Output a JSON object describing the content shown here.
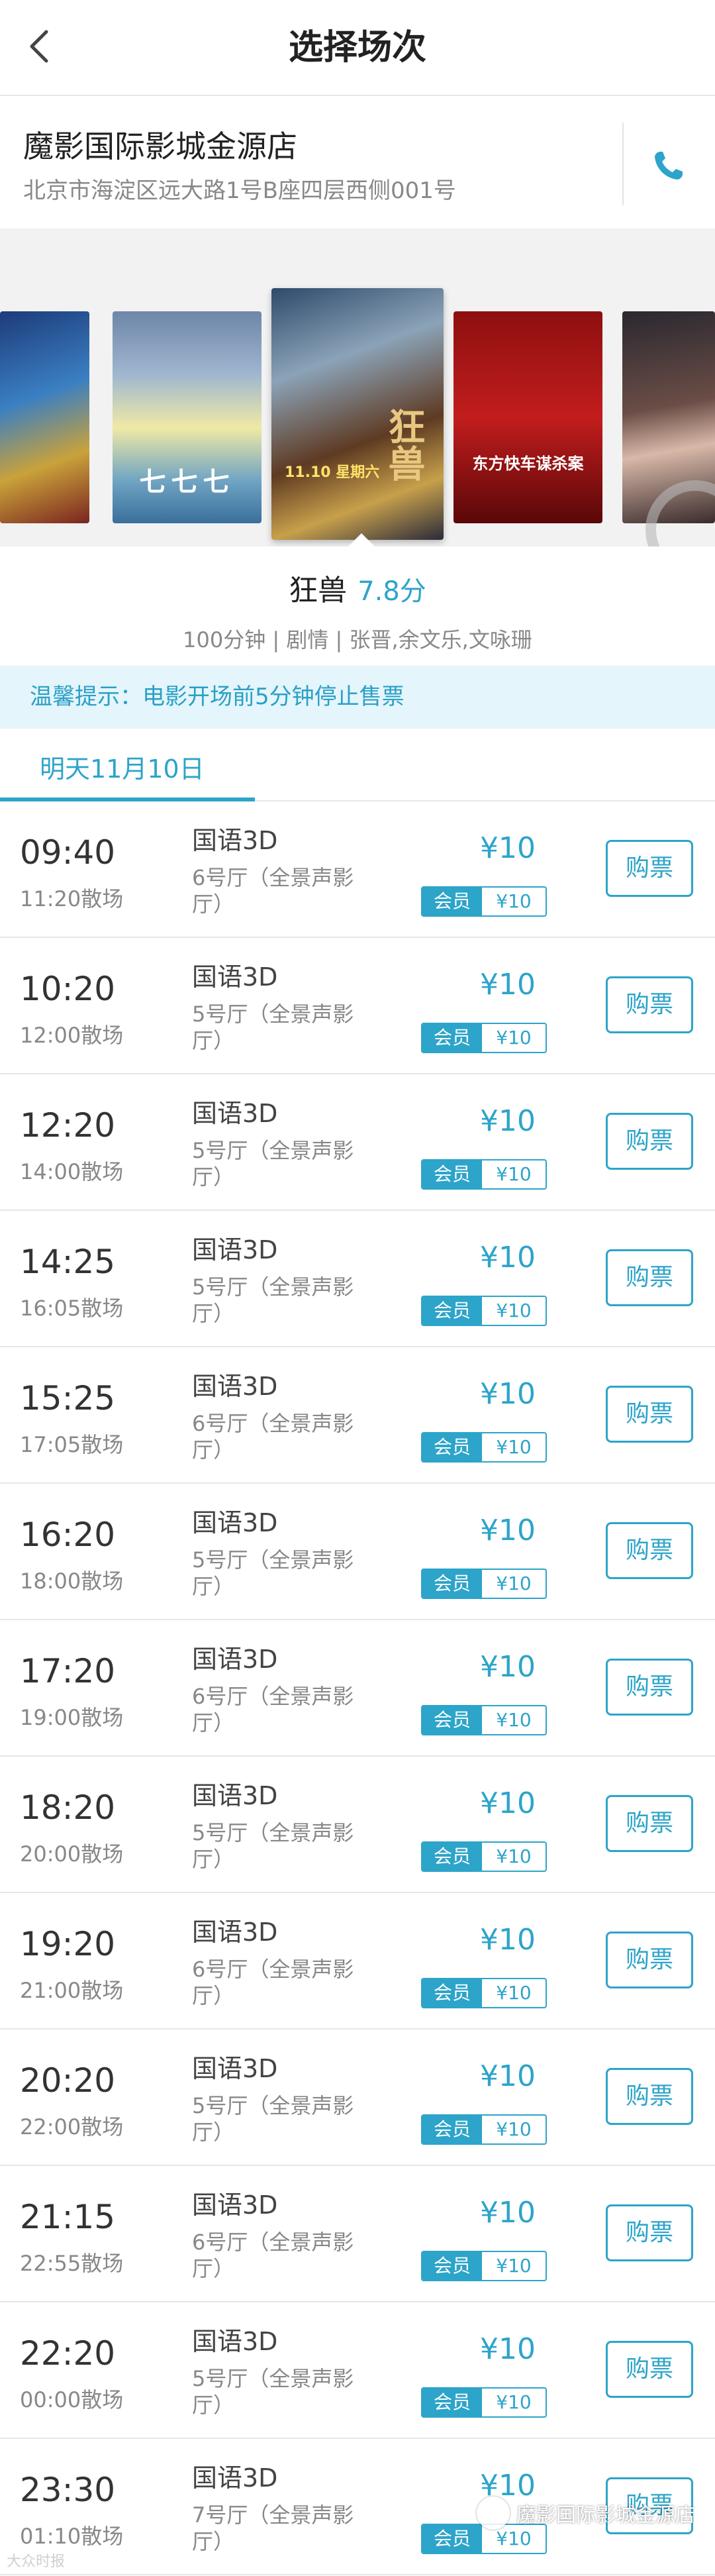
{
  "header": {
    "title": "选择场次"
  },
  "cinema": {
    "name": "魔影国际影城金源店",
    "address": "北京市海淀区远大路1号B座四层西侧001号"
  },
  "posters": {
    "p2_text": "七七七",
    "p3_text": "11.10 星期六",
    "p3_title": "狂兽",
    "p4_text": "东方快车谋杀案"
  },
  "movie": {
    "title": "狂兽",
    "score": "7.8分",
    "info": "100分钟 | 剧情 | 张晋,余文乐,文咏珊"
  },
  "notice": "温馨提示：电影开场前5分钟停止售票",
  "tabs": {
    "selected": "明天11月10日"
  },
  "labels": {
    "member": "会员",
    "buy": "购票"
  },
  "showtimes": [
    {
      "start": "09:40",
      "end": "11:20散场",
      "lang": "国语3D",
      "hall": "6号厅（全景声影厅）",
      "price": "¥10",
      "member_price": "¥10"
    },
    {
      "start": "10:20",
      "end": "12:00散场",
      "lang": "国语3D",
      "hall": "5号厅（全景声影厅）",
      "price": "¥10",
      "member_price": "¥10"
    },
    {
      "start": "12:20",
      "end": "14:00散场",
      "lang": "国语3D",
      "hall": "5号厅（全景声影厅）",
      "price": "¥10",
      "member_price": "¥10"
    },
    {
      "start": "14:25",
      "end": "16:05散场",
      "lang": "国语3D",
      "hall": "5号厅（全景声影厅）",
      "price": "¥10",
      "member_price": "¥10"
    },
    {
      "start": "15:25",
      "end": "17:05散场",
      "lang": "国语3D",
      "hall": "6号厅（全景声影厅）",
      "price": "¥10",
      "member_price": "¥10"
    },
    {
      "start": "16:20",
      "end": "18:00散场",
      "lang": "国语3D",
      "hall": "5号厅（全景声影厅）",
      "price": "¥10",
      "member_price": "¥10"
    },
    {
      "start": "17:20",
      "end": "19:00散场",
      "lang": "国语3D",
      "hall": "6号厅（全景声影厅）",
      "price": "¥10",
      "member_price": "¥10"
    },
    {
      "start": "18:20",
      "end": "20:00散场",
      "lang": "国语3D",
      "hall": "5号厅（全景声影厅）",
      "price": "¥10",
      "member_price": "¥10"
    },
    {
      "start": "19:20",
      "end": "21:00散场",
      "lang": "国语3D",
      "hall": "6号厅（全景声影厅）",
      "price": "¥10",
      "member_price": "¥10"
    },
    {
      "start": "20:20",
      "end": "22:00散场",
      "lang": "国语3D",
      "hall": "5号厅（全景声影厅）",
      "price": "¥10",
      "member_price": "¥10"
    },
    {
      "start": "21:15",
      "end": "22:55散场",
      "lang": "国语3D",
      "hall": "6号厅（全景声影厅）",
      "price": "¥10",
      "member_price": "¥10"
    },
    {
      "start": "22:20",
      "end": "00:00散场",
      "lang": "国语3D",
      "hall": "5号厅（全景声影厅）",
      "price": "¥10",
      "member_price": "¥10"
    },
    {
      "start": "23:30",
      "end": "01:10散场",
      "lang": "国语3D",
      "hall": "7号厅（全景声影厅）",
      "price": "¥10",
      "member_price": "¥10"
    }
  ],
  "watermarks": {
    "left": "大众时报",
    "right": "魔影国际影城金源店"
  },
  "colors": {
    "accent": "#2da4c9",
    "notice_bg": "#e4f5fb"
  },
  "icons": {
    "back": "chevron-left-icon",
    "phone": "phone-icon"
  }
}
